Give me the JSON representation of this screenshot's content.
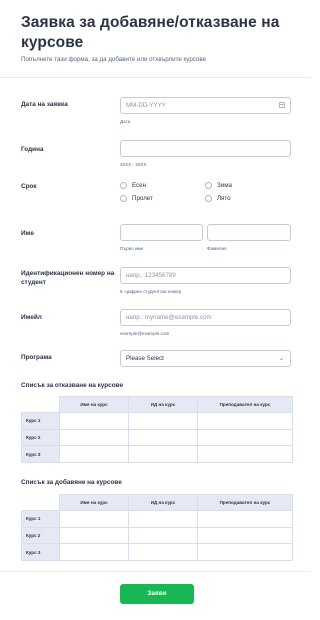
{
  "form": {
    "title": "Заявка за добавяне/отказване на курсове",
    "subtitle": "Попълнете тази форма, за да добавите или отхвърлите курсове"
  },
  "fields": {
    "date": {
      "label": "Дата на заявка",
      "placeholder": "MM-DD-YYYY",
      "sublabel": "Дата"
    },
    "year": {
      "label": "Година",
      "value": "",
      "sublabel": "20XX - 20XX"
    },
    "term": {
      "label": "Срок",
      "options": [
        "Есен",
        "Пролет",
        "Зима",
        "Лято"
      ]
    },
    "name": {
      "label": "Име",
      "first_sublabel": "Първо име",
      "last_sublabel": "Фамилия"
    },
    "student_id": {
      "label": "Идентификационен номер на студент",
      "placeholder": "напр.: 123456789",
      "sublabel": "8 -цифрен студентски номер"
    },
    "email": {
      "label": "Имейл",
      "placeholder": "напр.: myname@example.com",
      "sublabel": "example@example.com"
    },
    "program": {
      "label": "Програма",
      "selected": "Please Select"
    }
  },
  "drop_table": {
    "title": "Списък за отказване на курсове",
    "columns": [
      "Име на курс",
      "ИД на курс",
      "Преподавател на курс"
    ],
    "rows": [
      "Курс 1",
      "Курс 2",
      "Курс 3"
    ]
  },
  "add_table": {
    "title": "Списък за добавяне на курсове",
    "columns": [
      "Име на курс",
      "ИД на курс",
      "Преподавател на курс"
    ],
    "rows": [
      "Курс 1",
      "Курс 2",
      "Курс 3"
    ]
  },
  "submit_label": "Заяви",
  "icons": {
    "date": "calendar-icon",
    "select": "chevron-down-icon"
  },
  "colors": {
    "submit": "#18b754",
    "table_header": "#e4e9f4",
    "border": "#c3cad8"
  }
}
